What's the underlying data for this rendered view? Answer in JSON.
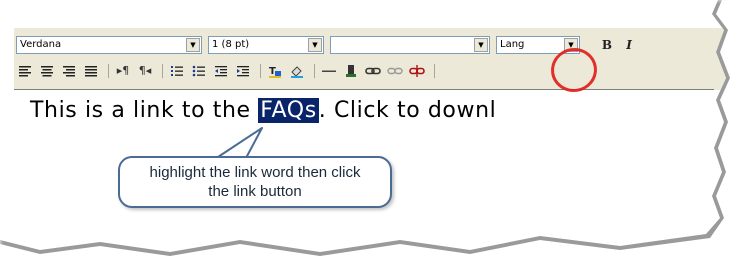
{
  "toolbar": {
    "font_name": "Verdana",
    "font_size": "1 (8 pt)",
    "style_value": "",
    "language": "Lang",
    "bold_label": "B",
    "italic_label": "I"
  },
  "editor": {
    "text_before": "This is a link to the ",
    "link_word": "FAQs",
    "text_after": ". Click to downl"
  },
  "callout": {
    "line1": "highlight the link word then click",
    "line2": "the link button"
  },
  "colors": {
    "highlight_ring": "#e0201a",
    "selection": "#0a246a",
    "callout_border": "#4b6b93",
    "toolbar_bg": "#ece9d8"
  }
}
